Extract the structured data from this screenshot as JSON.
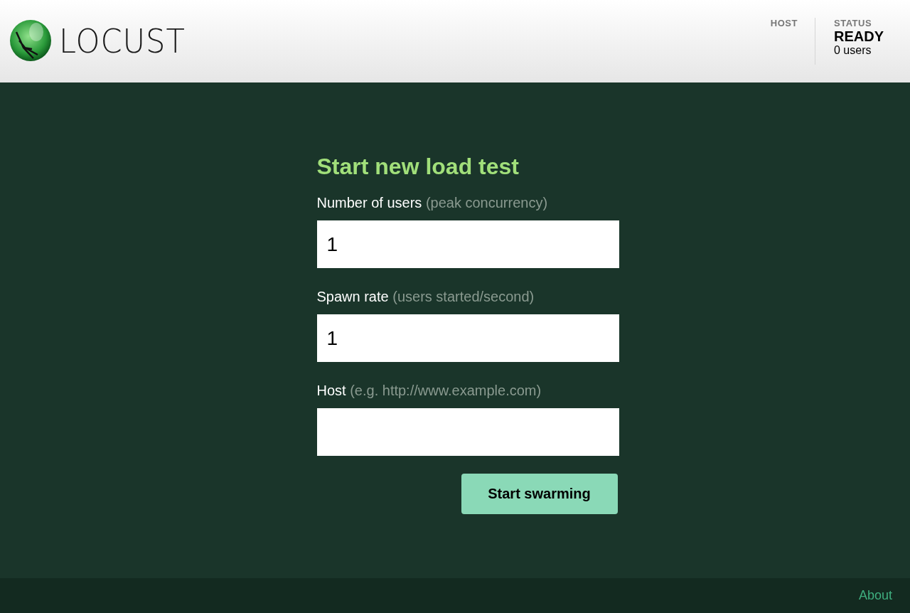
{
  "header": {
    "logo_text": "LOCUST",
    "stats": [
      {
        "label": "HOST"
      },
      {
        "label": "STATUS",
        "value": "READY",
        "detail": "0 users"
      }
    ]
  },
  "form": {
    "title": "Start new load test",
    "fields": [
      {
        "label": "Number of users",
        "hint": "(peak concurrency)",
        "value": "1"
      },
      {
        "label": "Spawn rate",
        "hint": "(users started/second)",
        "value": "1"
      },
      {
        "label": "Host",
        "hint": "(e.g. http://www.example.com)"
      }
    ],
    "submit": "Start swarming"
  },
  "footer": {
    "link": "About"
  }
}
